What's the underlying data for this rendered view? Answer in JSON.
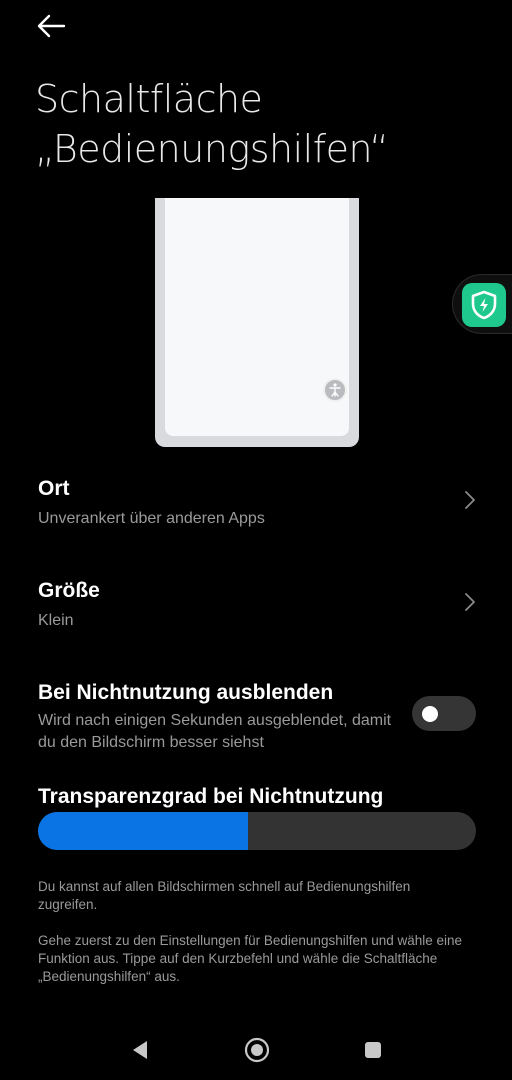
{
  "header": {
    "back_icon": "arrow-left-icon",
    "title": "Schaltfläche „Bedienungshilfen“"
  },
  "preview": {
    "floating_icon": "accessibility-icon"
  },
  "floating_shortcut": {
    "icon": "shield-bolt-icon",
    "color": "#1fc98d"
  },
  "settings": {
    "location": {
      "title": "Ort",
      "value": "Unverankert über anderen Apps"
    },
    "size": {
      "title": "Größe",
      "value": "Klein"
    },
    "hide_when_unused": {
      "title": "Bei Nichtnutzung ausblenden",
      "description": "Wird nach einigen Sekunden ausgeblendet, damit du den Bildschirm besser siehst",
      "enabled": false
    },
    "transparency": {
      "title": "Transparenzgrad bei Nichtnutzung",
      "level": 0.48,
      "fill_color": "#0a74e4"
    }
  },
  "info": {
    "paragraph1": "Du kannst auf allen Bildschirmen schnell auf Bedienungshilfen zugreifen.",
    "paragraph2": "Gehe zuerst zu den Einstellungen für Bedienungshilfen und wähle eine Funktion aus. Tippe auf den Kurzbefehl und wähle die Schaltfläche „Bedienungshilfen“ aus."
  },
  "navbar": {
    "back_icon": "nav-back-icon",
    "home_icon": "nav-home-icon",
    "recents_icon": "nav-recents-icon"
  }
}
